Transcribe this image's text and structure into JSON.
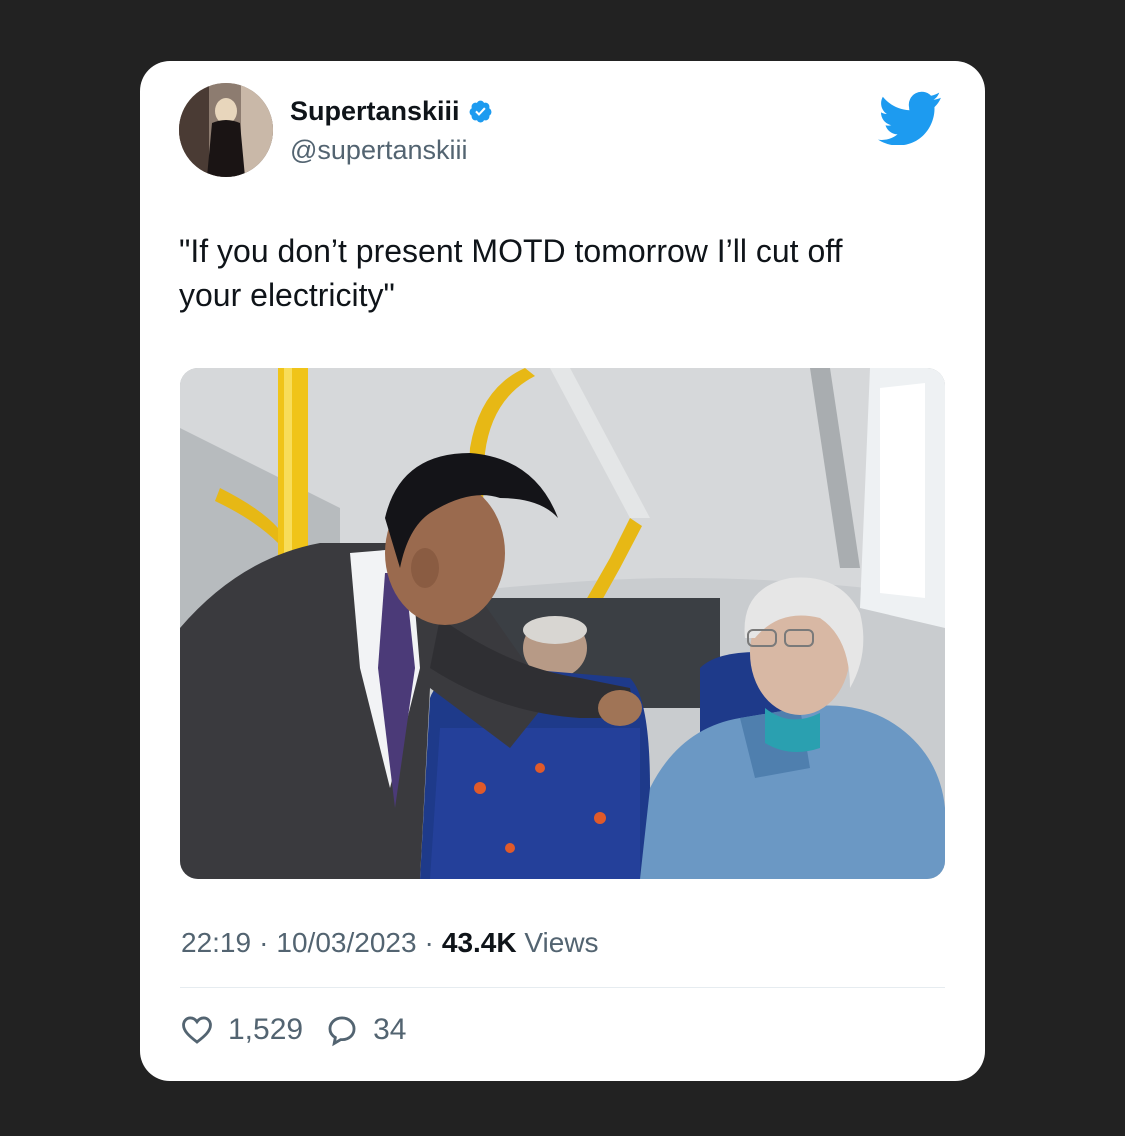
{
  "author": {
    "display_name": "Supertanskiii",
    "handle": "@supertanskiii",
    "verified": true
  },
  "tweet": {
    "text": "\"If you don’t present MOTD tomorrow I’ll cut off\nyour electricity\""
  },
  "meta": {
    "time": "22:19",
    "date": "10/03/2023",
    "separator": "·",
    "views_count": "43.4K",
    "views_label": "Views"
  },
  "actions": {
    "likes": "1,529",
    "replies": "34"
  },
  "colors": {
    "brand": "#1d9bf0",
    "text": "#0f1419",
    "secondary": "#536471",
    "background": "#222222"
  },
  "icons": {
    "verified": "verified-badge-icon",
    "brand": "twitter-bird-icon",
    "like": "heart-icon",
    "reply": "reply-bubble-icon"
  }
}
